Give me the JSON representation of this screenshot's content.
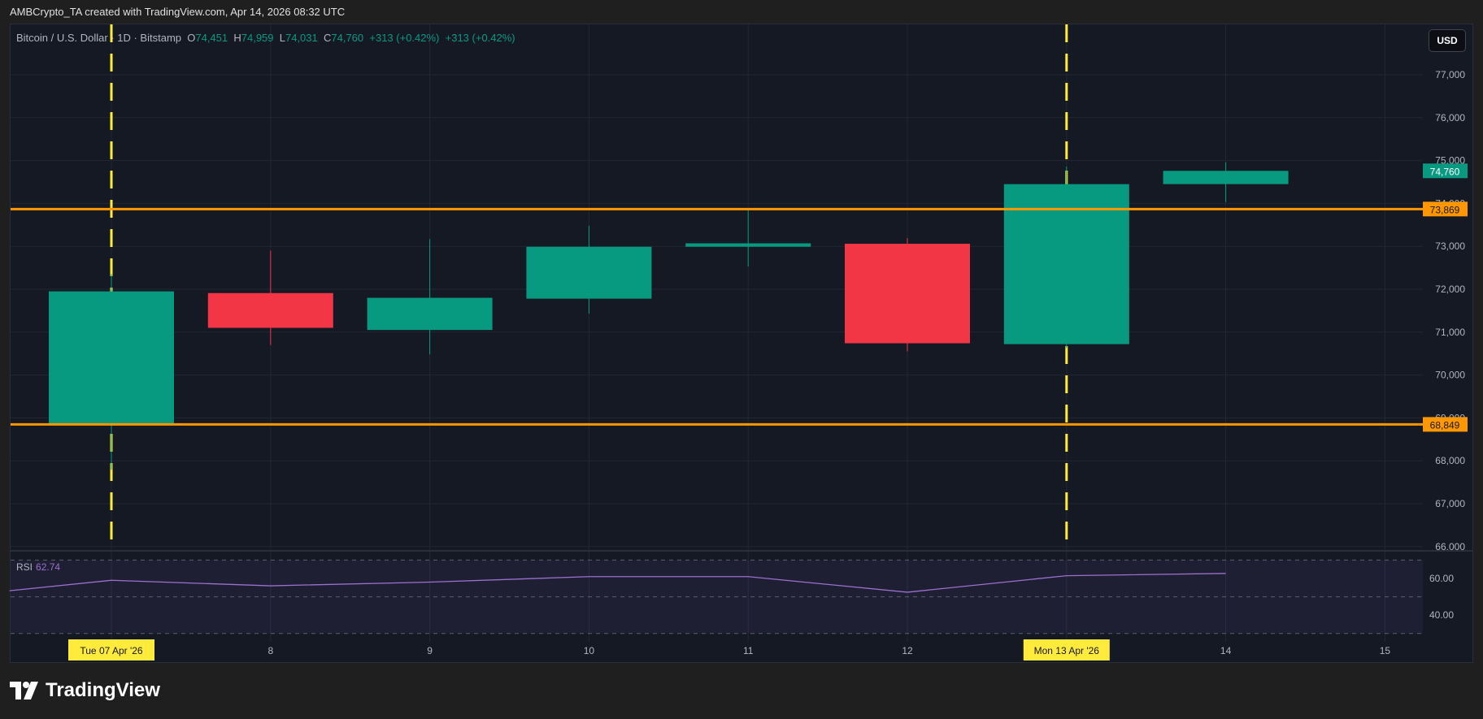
{
  "credit": "AMBCrypto_TA created with TradingView.com, Apr 14, 2026 08:32 UTC",
  "legend": {
    "symbol": "Bitcoin / U.S. Dollar · 1D · Bitstamp",
    "o_label": "O",
    "o": "74,451",
    "h_label": "H",
    "h": "74,959",
    "l_label": "L",
    "l": "74,031",
    "c_label": "C",
    "c": "74,760",
    "change1": "+313 (+0.42%)",
    "change2": "+313 (+0.42%)"
  },
  "currency": "USD",
  "rsi": {
    "label": "RSI",
    "value": "62.74"
  },
  "logo_text": "TradingView",
  "colors": {
    "up": "#089981",
    "down": "#f23645",
    "level": "#ff9800",
    "marker": "#ffeb3b",
    "rsi": "#9c6fcf"
  },
  "chart_data": {
    "type": "candlestick",
    "title": "Bitcoin / U.S. Dollar · 1D · Bitstamp",
    "x": [
      "Tue 07 Apr '26",
      "8",
      "9",
      "10",
      "11",
      "12",
      "Mon 13 Apr '26",
      "14"
    ],
    "x_ticks": [
      "Tue 07 Apr '26",
      "8",
      "9",
      "10",
      "11",
      "12",
      "Mon 13 Apr '26",
      "14",
      "15"
    ],
    "ohlc": [
      {
        "day": 7,
        "o": 68849,
        "h": 72350,
        "l": 67790,
        "c": 71950
      },
      {
        "day": 8,
        "o": 71910,
        "h": 72900,
        "l": 70700,
        "c": 71100
      },
      {
        "day": 9,
        "o": 71050,
        "h": 73170,
        "l": 70480,
        "c": 71800
      },
      {
        "day": 10,
        "o": 71780,
        "h": 73480,
        "l": 71430,
        "c": 72990
      },
      {
        "day": 11,
        "o": 72990,
        "h": 73870,
        "l": 72530,
        "c": 73070
      },
      {
        "day": 12,
        "o": 73060,
        "h": 73190,
        "l": 70550,
        "c": 70740
      },
      {
        "day": 13,
        "o": 70720,
        "h": 74860,
        "l": 70630,
        "c": 74450
      },
      {
        "day": 14,
        "o": 74451,
        "h": 74959,
        "l": 74031,
        "c": 74760
      }
    ],
    "y_ticks": [
      "77,000",
      "76,000",
      "75,000",
      "74,000",
      "73,000",
      "72,000",
      "71,000",
      "70,000",
      "69,000",
      "68,000",
      "67,000",
      "66,000"
    ],
    "ylim": [
      65950,
      77600
    ],
    "levels": [
      {
        "value": 73869,
        "label": "73,869"
      },
      {
        "value": 68849,
        "label": "68,849"
      }
    ],
    "last_price": {
      "value": 74760,
      "label": "74,760"
    },
    "vertical_markers": [
      7,
      13
    ],
    "rsi": {
      "days": [
        6.36,
        7,
        8,
        9,
        10,
        11,
        12,
        13,
        14
      ],
      "values": [
        53.3,
        59,
        56,
        58,
        61,
        61,
        52.5,
        61.5,
        62.74
      ],
      "y_ticks": [
        "60.00",
        "40.00"
      ],
      "bands": [
        70,
        50,
        30
      ]
    }
  }
}
